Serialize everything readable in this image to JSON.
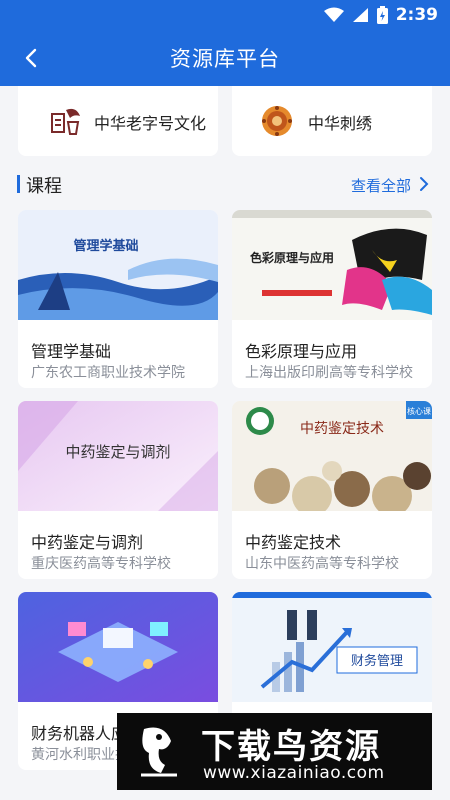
{
  "status_bar": {
    "time": "2:39"
  },
  "header": {
    "title": "资源库平台"
  },
  "culture": [
    {
      "label": "中华老字号文化"
    },
    {
      "label": "中华刺绣"
    }
  ],
  "courses_section": {
    "heading": "课程",
    "view_all": "查看全部"
  },
  "courses": [
    {
      "name": "管理学基础",
      "school": "广东农工商职业技术学院",
      "thumb_text": "管理学基础"
    },
    {
      "name": "色彩原理与应用",
      "school": "上海出版印刷高等专科学校",
      "thumb_text": "色彩原理与应用"
    },
    {
      "name": "中药鉴定与调剂",
      "school": "重庆医药高等专科学校",
      "thumb_text": "中药鉴定与调剂"
    },
    {
      "name": "中药鉴定技术",
      "school": "山东中医药高等专科学校",
      "thumb_text": "中药鉴定技术",
      "badge": "核心课"
    },
    {
      "name": "财务机器人应用",
      "school": "黄河水利职业技术学院",
      "thumb_text": ""
    },
    {
      "name": "",
      "school": "",
      "thumb_text": "财务管理"
    }
  ],
  "watermark": {
    "title": "下载鸟资源",
    "url": "www.xiazainiao.com"
  }
}
